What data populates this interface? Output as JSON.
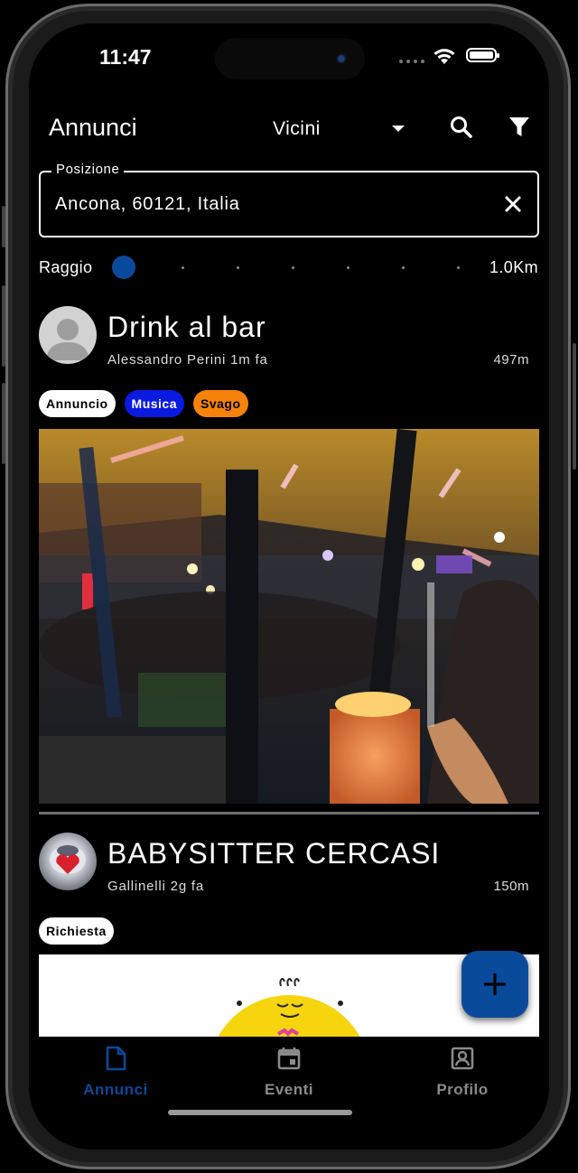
{
  "status_bar": {
    "time": "11:47"
  },
  "app_bar": {
    "title": "Annunci",
    "sort_value": "Vicini",
    "search_icon": "search-icon",
    "filter_icon": "filter-icon"
  },
  "location": {
    "label": "Posizione",
    "value": "Ancona, 60121, Italia",
    "clear_icon": "close-icon"
  },
  "radius": {
    "label": "Raggio",
    "value_label": "1.0Km",
    "level": 0
  },
  "posts": [
    {
      "title": "Drink al bar",
      "author": "Alessandro Perini",
      "time": "1m fa",
      "distance": "497m",
      "tags": [
        {
          "label": "Annuncio",
          "bg": "#ffffff",
          "fg": "#000000"
        },
        {
          "label": "Musica",
          "bg": "#0a1adf",
          "fg": "#ffffff"
        },
        {
          "label": "Svago",
          "bg": "#f5820b",
          "fg": "#000000"
        }
      ]
    },
    {
      "title": "BABYSITTER CERCASI",
      "author": "Gallinelli",
      "time": "2g fa",
      "distance": "150m",
      "tags": [
        {
          "label": "Richiesta",
          "bg": "#ffffff",
          "fg": "#000000"
        }
      ]
    }
  ],
  "fab": {
    "icon": "plus-icon"
  },
  "bottom_nav": {
    "items": [
      {
        "label": "Annunci",
        "icon": "document-icon",
        "active": true
      },
      {
        "label": "Eventi",
        "icon": "calendar-icon",
        "active": false
      },
      {
        "label": "Profilo",
        "icon": "profile-icon",
        "active": false
      }
    ]
  },
  "colors": {
    "accent": "#0a4a9a",
    "background": "#000000",
    "inactive_nav": "#8a8a8a"
  }
}
